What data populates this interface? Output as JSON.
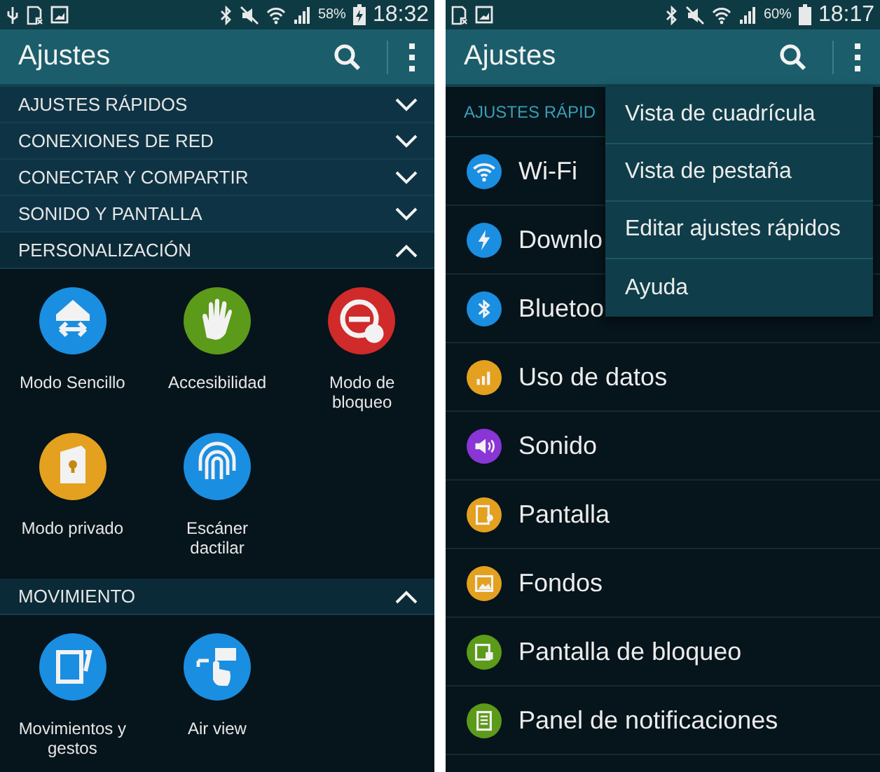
{
  "screens": [
    {
      "status_bar": {
        "battery": "58%",
        "time": "18:32"
      },
      "app_bar": {
        "title": "Ajustes"
      },
      "sections": [
        {
          "title": "AJUSTES RÁPIDOS",
          "expanded": false
        },
        {
          "title": "CONEXIONES DE RED",
          "expanded": false
        },
        {
          "title": "CONECTAR Y COMPARTIR",
          "expanded": false
        },
        {
          "title": "SONIDO Y PANTALLA",
          "expanded": false
        },
        {
          "title": "PERSONALIZACIÓN",
          "expanded": true,
          "items": [
            {
              "label": "Modo Sencillo",
              "color": "#1a8ee0"
            },
            {
              "label": "Accesibilidad",
              "color": "#5c9a1a"
            },
            {
              "label": "Modo de bloqueo",
              "color": "#d02a2a"
            },
            {
              "label": "Modo privado",
              "color": "#e3a11f"
            },
            {
              "label": "Escáner dactilar",
              "color": "#1a8ee0"
            }
          ]
        },
        {
          "title": "MOVIMIENTO",
          "expanded": true,
          "items": [
            {
              "label": "Movimientos y gestos",
              "color": "#1a8ee0"
            },
            {
              "label": "Air view",
              "color": "#1a8ee0"
            }
          ]
        }
      ]
    },
    {
      "status_bar": {
        "battery": "60%",
        "time": "18:17"
      },
      "app_bar": {
        "title": "Ajustes"
      },
      "list_header": "AJUSTES RÁPID",
      "list": [
        {
          "label": "Wi-Fi",
          "color": "#1a8ee0"
        },
        {
          "label": "Downlo",
          "color": "#1a8ee0"
        },
        {
          "label": "Bluetoo",
          "color": "#1a8ee0"
        },
        {
          "label": "Uso de datos",
          "color": "#e3a11f"
        },
        {
          "label": "Sonido",
          "color": "#8a35d6"
        },
        {
          "label": "Pantalla",
          "color": "#e3a11f"
        },
        {
          "label": "Fondos",
          "color": "#e3a11f"
        },
        {
          "label": "Pantalla de bloqueo",
          "color": "#5c9a1a"
        },
        {
          "label": "Panel de notificaciones",
          "color": "#5c9a1a"
        }
      ],
      "menu": [
        "Vista de cuadrícula",
        "Vista de pestaña",
        "Editar ajustes rápidos",
        "Ayuda"
      ]
    }
  ]
}
